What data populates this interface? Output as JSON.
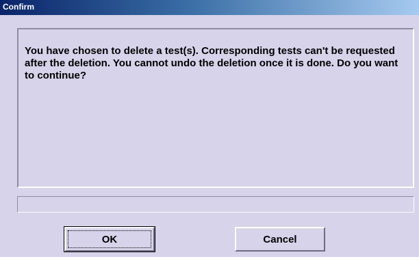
{
  "window": {
    "title": "Confirm"
  },
  "message": {
    "text": "You have chosen to delete a test(s). Corresponding tests can't be requested after the deletion. You cannot undo the deletion once it is done. Do you want to continue?"
  },
  "status_field": {
    "value": ""
  },
  "buttons": {
    "ok_label": "OK",
    "cancel_label": "Cancel"
  },
  "colors": {
    "dialog_background": "#d6d3ea",
    "titlebar_start": "#0a246a",
    "titlebar_end": "#a6caf0",
    "title_text": "#ffffff"
  }
}
